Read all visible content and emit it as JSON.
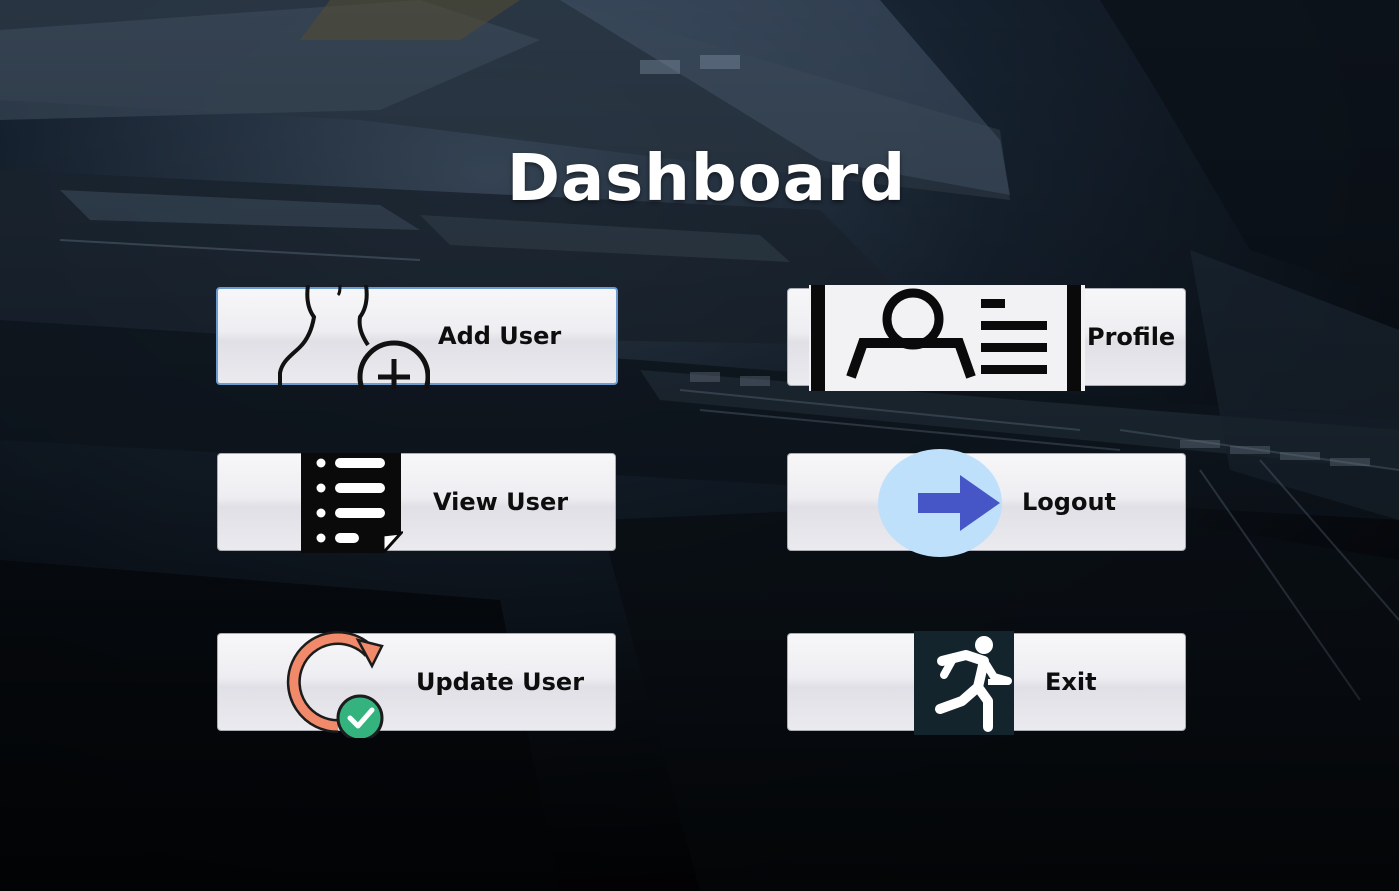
{
  "window": {
    "title": "Dashboard"
  },
  "buttons": {
    "add_user": {
      "label": "Add User",
      "icon": "add-user-icon"
    },
    "view_user": {
      "label": "View User",
      "icon": "list-icon"
    },
    "update_user": {
      "label": "Update User",
      "icon": "refresh-check-icon"
    },
    "profile": {
      "label": "Profile",
      "icon": "profile-card-icon"
    },
    "logout": {
      "label": "Logout",
      "icon": "arrow-right-icon"
    },
    "exit": {
      "label": "Exit",
      "icon": "running-man-icon"
    }
  },
  "colors": {
    "background": "#0b1017",
    "title": "#ffffff",
    "button_face": "#eeeef2",
    "focus_border": "#6a9bd1",
    "logout_circle": "#bfe0fb",
    "logout_arrow": "#4656c7",
    "update_arc": "#f08a6b",
    "update_check": "#35b37e",
    "exit_tile": "#14242c"
  }
}
